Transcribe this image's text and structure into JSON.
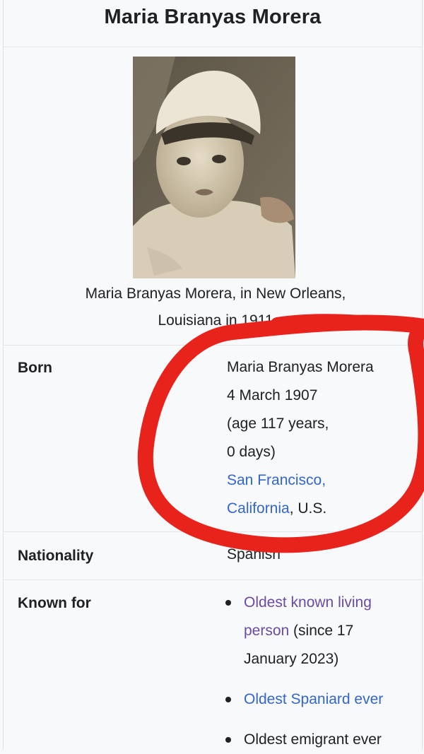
{
  "infobox": {
    "title": "Maria Branyas Morera",
    "image_alt": "Photo of Maria Branyas Morera as a child",
    "caption_line1": "Maria Branyas Morera, in New Orleans,",
    "caption_line2": "Louisiana in 1911"
  },
  "born": {
    "label": "Born",
    "name": "Maria Branyas Morera",
    "date": "4 March 1907",
    "age_line1": "(age 117 years,",
    "age_line2": "0 days)",
    "place_link1": "San Francisco,",
    "place_link2": "California",
    "place_suffix": ", U.S."
  },
  "nationality": {
    "label": "Nationality",
    "value": "Spanish"
  },
  "known_for": {
    "label": "Known for",
    "items": [
      {
        "link_line1": "Oldest known living",
        "link_line2": "person",
        "text": " (since 17",
        "text2": "January 2023)"
      },
      {
        "link": "Oldest Spaniard ever"
      },
      {
        "text": "Oldest emigrant ever"
      }
    ]
  },
  "colors": {
    "link": "#3366cc",
    "visited_link": "#6b4ba1",
    "annotation": "#e8231c",
    "background": "#f8f9fa"
  }
}
